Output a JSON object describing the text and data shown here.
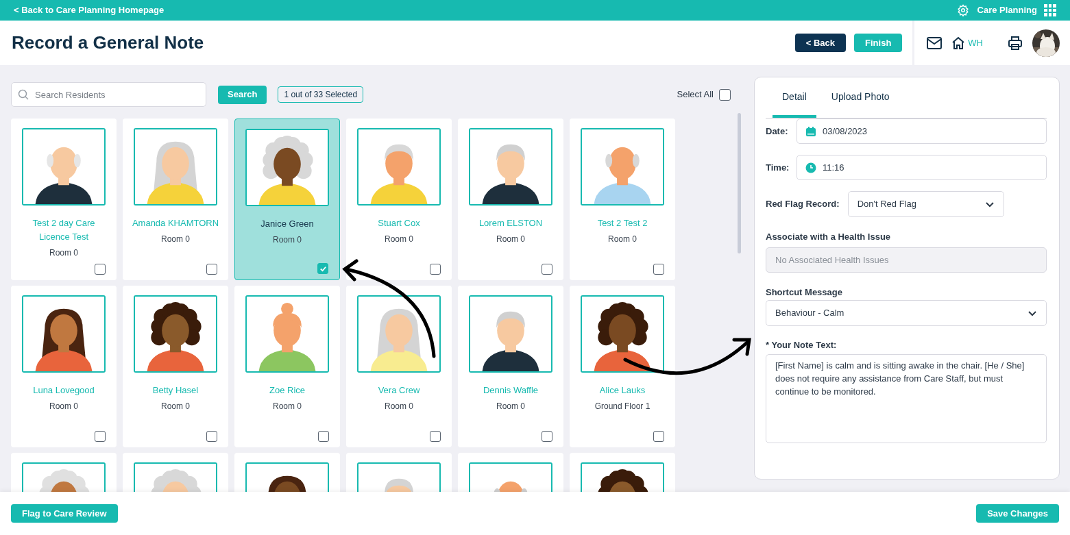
{
  "top_bar": {
    "back_link": "< Back to Care Planning Homepage",
    "app_name": "Care Planning"
  },
  "header": {
    "title": "Record a General Note",
    "buttons": [
      {
        "label": "< Back",
        "kind": "secondary"
      },
      {
        "label": "Finish",
        "kind": "primary"
      }
    ],
    "home_label": "WH"
  },
  "search": {
    "placeholder": "Search Residents",
    "button": "Search",
    "selection_count": "1 out of 33 Selected",
    "select_all": {
      "label": "Select All",
      "checked": false
    }
  },
  "residents": [
    {
      "name": "Test 2 day Care Licence Test",
      "room": "Room 0",
      "selected": false
    },
    {
      "name": "Amanda KHAMTORN",
      "room": "Room 0",
      "selected": false
    },
    {
      "name": "Janice Green",
      "room": "Room 0",
      "selected": true
    },
    {
      "name": "Stuart Cox",
      "room": "Room 0",
      "selected": false
    },
    {
      "name": "Lorem ELSTON",
      "room": "Room 0",
      "selected": false
    },
    {
      "name": "Test 2 Test 2",
      "room": "Room 0",
      "selected": false
    },
    {
      "name": "Luna Lovegood",
      "room": "Room 0",
      "selected": false
    },
    {
      "name": "Betty Hasel",
      "room": "Room 0",
      "selected": false
    },
    {
      "name": "Zoe Rice",
      "room": "Room 0",
      "selected": false
    },
    {
      "name": "Vera Crew",
      "room": "Room 0",
      "selected": false
    },
    {
      "name": "Dennis Waffle",
      "room": "Room 0",
      "selected": false
    },
    {
      "name": "Alice Lauks",
      "room": "Ground Floor 1",
      "selected": false
    }
  ],
  "detail_panel": {
    "tabs": [
      {
        "label": "Detail",
        "selected": true
      },
      {
        "label": "Upload Photo",
        "selected": false
      }
    ],
    "date": {
      "label": "Date:",
      "value": "03/08/2023"
    },
    "time": {
      "label": "Time:",
      "value": "11:16"
    },
    "red_flag": {
      "label": "Red Flag Record:",
      "value": "Don't Red Flag"
    },
    "health_issue": {
      "label": "Associate with a Health Issue",
      "placeholder": "No Associated Health Issues",
      "disabled": true
    },
    "shortcut": {
      "label": "Shortcut Message",
      "value": "Behaviour - Calm"
    },
    "note": {
      "label": "* Your Note Text:",
      "value": "[First Name] is calm and is sitting awake in the chair. [He / She] does not require any assistance from Care Staff, but must continue to be monitored."
    }
  },
  "footer": {
    "buttons": [
      "Flag to Care Review",
      "Save Changes"
    ]
  }
}
